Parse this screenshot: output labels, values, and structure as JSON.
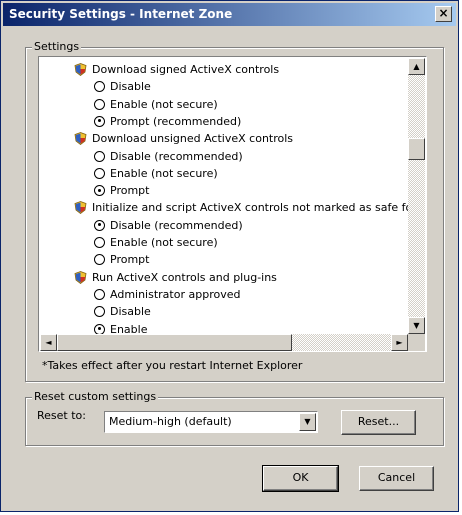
{
  "window": {
    "title": "Security Settings - Internet Zone",
    "close_label": "×"
  },
  "settings_group": {
    "label": "Settings",
    "items": [
      {
        "kind": "category",
        "icon": "settings-category-icon",
        "label": "Download signed ActiveX controls"
      },
      {
        "kind": "option",
        "label": "Disable",
        "selected": false
      },
      {
        "kind": "option",
        "label": "Enable (not secure)",
        "selected": false
      },
      {
        "kind": "option",
        "label": "Prompt (recommended)",
        "selected": true
      },
      {
        "kind": "category",
        "icon": "settings-category-icon",
        "label": "Download unsigned ActiveX controls"
      },
      {
        "kind": "option",
        "label": "Disable (recommended)",
        "selected": false
      },
      {
        "kind": "option",
        "label": "Enable (not secure)",
        "selected": false
      },
      {
        "kind": "option",
        "label": "Prompt",
        "selected": true
      },
      {
        "kind": "category",
        "icon": "settings-category-icon",
        "label": "Initialize and script ActiveX controls not marked as safe for sc"
      },
      {
        "kind": "option",
        "label": "Disable (recommended)",
        "selected": true
      },
      {
        "kind": "option",
        "label": "Enable (not secure)",
        "selected": false
      },
      {
        "kind": "option",
        "label": "Prompt",
        "selected": false
      },
      {
        "kind": "category",
        "icon": "settings-category-icon",
        "label": "Run ActiveX controls and plug-ins"
      },
      {
        "kind": "option",
        "label": "Administrator approved",
        "selected": false
      },
      {
        "kind": "option",
        "label": "Disable",
        "selected": false
      },
      {
        "kind": "option",
        "label": "Enable",
        "selected": true
      }
    ],
    "note": "*Takes effect after you restart Internet Explorer"
  },
  "reset_group": {
    "label": "Reset custom settings",
    "reset_to_label": "Reset to:",
    "selected_level": "Medium-high (default)",
    "reset_button": "Reset..."
  },
  "footer": {
    "ok_label": "OK",
    "cancel_label": "Cancel"
  },
  "colors": {
    "titlebar_start": "#0a246a",
    "titlebar_end": "#a6caf0",
    "dialog_face": "#d4d0c8"
  }
}
